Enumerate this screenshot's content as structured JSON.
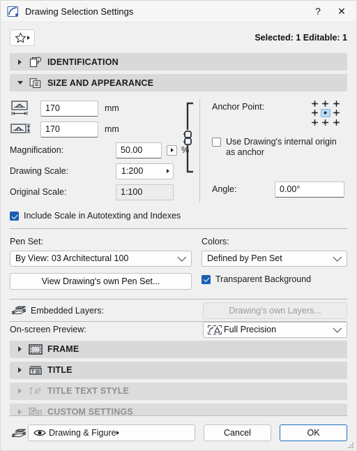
{
  "window": {
    "title": "Drawing Selection Settings",
    "app_icon": "arc-drawing-icon",
    "help_label": "?",
    "close_label": "✕"
  },
  "toolbar": {
    "favorites_icon": "star-icon",
    "favorites_arrow": "triangle-right-icon",
    "selection_status": "Selected: 1 Editable: 1"
  },
  "sections": [
    {
      "key": "identification",
      "label": "IDENTIFICATION",
      "icon": "document-info-icon",
      "expanded": false,
      "enabled": true
    },
    {
      "key": "size_and_appearance",
      "label": "SIZE AND APPEARANCE",
      "icon": "document-copy-icon",
      "expanded": true,
      "enabled": true
    },
    {
      "key": "frame",
      "label": "FRAME",
      "icon": "dashed-frame-icon",
      "expanded": false,
      "enabled": true
    },
    {
      "key": "title",
      "label": "TITLE",
      "icon": "title-bar-icon",
      "expanded": false,
      "enabled": true
    },
    {
      "key": "title_text_style",
      "label": "TITLE TEXT STYLE",
      "icon": "text-style-icon",
      "expanded": false,
      "enabled": false
    },
    {
      "key": "custom_settings",
      "label": "CUSTOM SETTINGS",
      "icon": "custom-settings-icon",
      "expanded": false,
      "enabled": false
    }
  ],
  "size_and_appearance": {
    "width": {
      "icon": "drawing-width-icon",
      "value": "170",
      "unit": "mm"
    },
    "height": {
      "icon": "drawing-height-icon",
      "value": "170",
      "unit": "mm"
    },
    "magnification": {
      "label": "Magnification:",
      "value": "50.00",
      "unit": "%"
    },
    "drawing_scale": {
      "label": "Drawing Scale:",
      "value": "1:200"
    },
    "original_scale": {
      "label": "Original Scale:",
      "value": "1:100"
    },
    "link_icon": "chain-link-icon",
    "include_scale": {
      "label": "Include Scale in Autotexting and Indexes",
      "checked": true
    },
    "anchor_point": {
      "label": "Anchor Point:",
      "selected_index": 4,
      "cells": 9
    },
    "use_internal_origin": {
      "label": "Use Drawing's internal origin as anchor",
      "checked": false
    },
    "angle": {
      "label": "Angle:",
      "value": "0.00°"
    }
  },
  "pen_and_colors": {
    "pen_set_label": "Pen Set:",
    "pen_set_value": "By View: 03 Architectural 100",
    "colors_label": "Colors:",
    "colors_value": "Defined by Pen Set",
    "view_pen_set_button": "View Drawing's own Pen Set...",
    "transparent_background": {
      "label": "Transparent Background",
      "checked": true
    }
  },
  "embedded_layers": {
    "icon": "layers-stack-icon",
    "label": "Embedded Layers:",
    "button_label": "Drawing's own Layers...",
    "button_enabled": false
  },
  "on_screen_preview": {
    "label": "On-screen Preview:",
    "value": "Full Precision",
    "icon": "preview-precision-icon"
  },
  "footer": {
    "layers_icon": "layers-stack-icon",
    "layer_combo_icon": "eye-icon",
    "layer_combo_value": "Drawing & Figure",
    "cancel_label": "Cancel",
    "ok_label": "OK"
  },
  "colors": {
    "dialog_bg": "#f0f0f0",
    "titlebar_bg": "#f6f6f6",
    "section_bg": "#d9d9d9",
    "accent_blue": "#1a5fb4",
    "ok_border": "#1a6fc4",
    "anchor_selected": "#bedcf5",
    "disabled_text": "#909090"
  }
}
